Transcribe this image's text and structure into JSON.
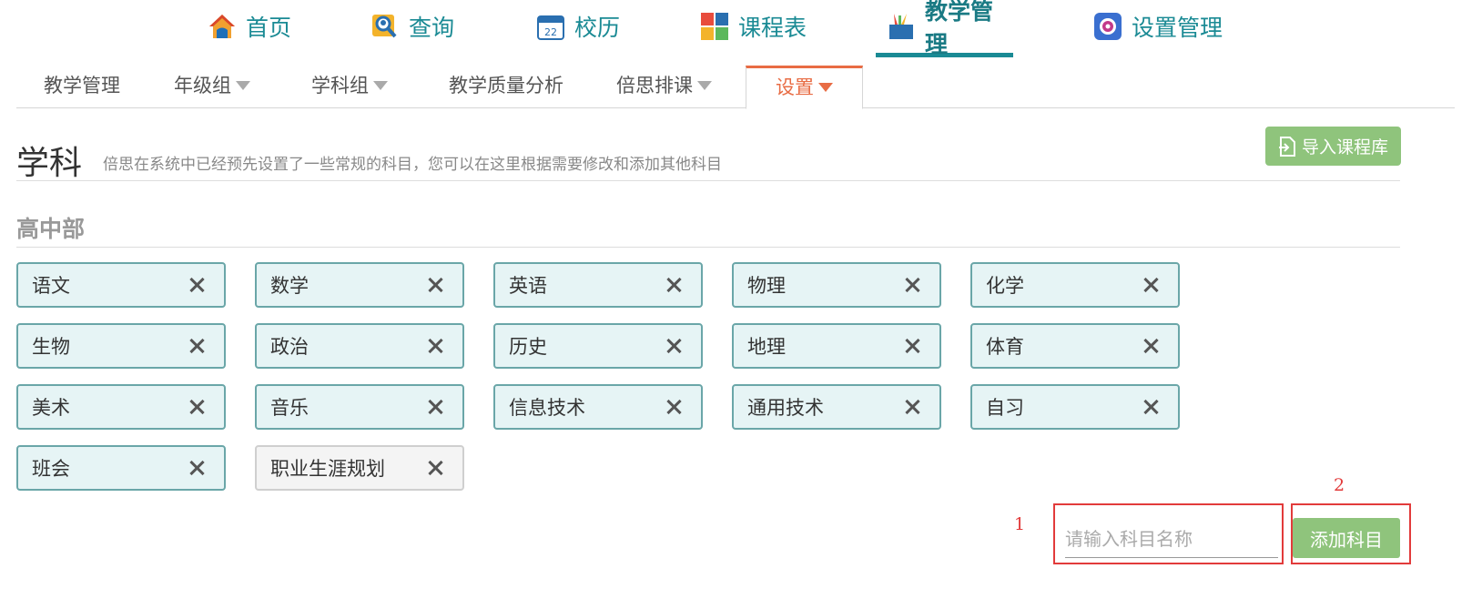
{
  "topnav": {
    "tabs": [
      {
        "label": "首页",
        "icon": "home-icon"
      },
      {
        "label": "查询",
        "icon": "search-person-icon"
      },
      {
        "label": "校历",
        "icon": "calendar-icon"
      },
      {
        "label": "课程表",
        "icon": "timetable-icon"
      },
      {
        "label": "教学管理",
        "icon": "teaching-icon",
        "active": true
      },
      {
        "label": "设置管理",
        "icon": "settings-gear-icon"
      }
    ]
  },
  "subnav": {
    "tabs": [
      {
        "label": "教学管理"
      },
      {
        "label": "年级组",
        "dropdown": true
      },
      {
        "label": "学科组",
        "dropdown": true
      },
      {
        "label": "教学质量分析"
      },
      {
        "label": "倍思排课",
        "dropdown": true
      },
      {
        "label": "设置",
        "dropdown": true,
        "active": true
      }
    ]
  },
  "section": {
    "title": "学科",
    "description": "倍思在系统中已经预先设置了一些常规的科目，您可以在这里根据需要修改和添加其他科目",
    "import_button": "导入课程库"
  },
  "group": {
    "title": "高中部",
    "subjects": [
      {
        "name": "语文"
      },
      {
        "name": "数学"
      },
      {
        "name": "英语"
      },
      {
        "name": "物理"
      },
      {
        "name": "化学"
      },
      {
        "name": "生物"
      },
      {
        "name": "政治"
      },
      {
        "name": "历史"
      },
      {
        "name": "地理"
      },
      {
        "name": "体育"
      },
      {
        "name": "美术"
      },
      {
        "name": "音乐"
      },
      {
        "name": "信息技术"
      },
      {
        "name": "通用技术"
      },
      {
        "name": "自习"
      },
      {
        "name": "班会"
      },
      {
        "name": "职业生涯规划",
        "inactive": true
      }
    ]
  },
  "add_form": {
    "input_placeholder": "请输入科目名称",
    "input_value": "",
    "add_button": "添加科目"
  },
  "annotations": {
    "label_1": "1",
    "label_2": "2"
  },
  "colors": {
    "nav_teal": "#1a8a94",
    "active_orange": "#e86c44",
    "chip_bg": "#e6f4f5",
    "chip_border": "#6aa6a8",
    "button_green": "#8fc47c",
    "annotation_red": "#e23b3b"
  }
}
